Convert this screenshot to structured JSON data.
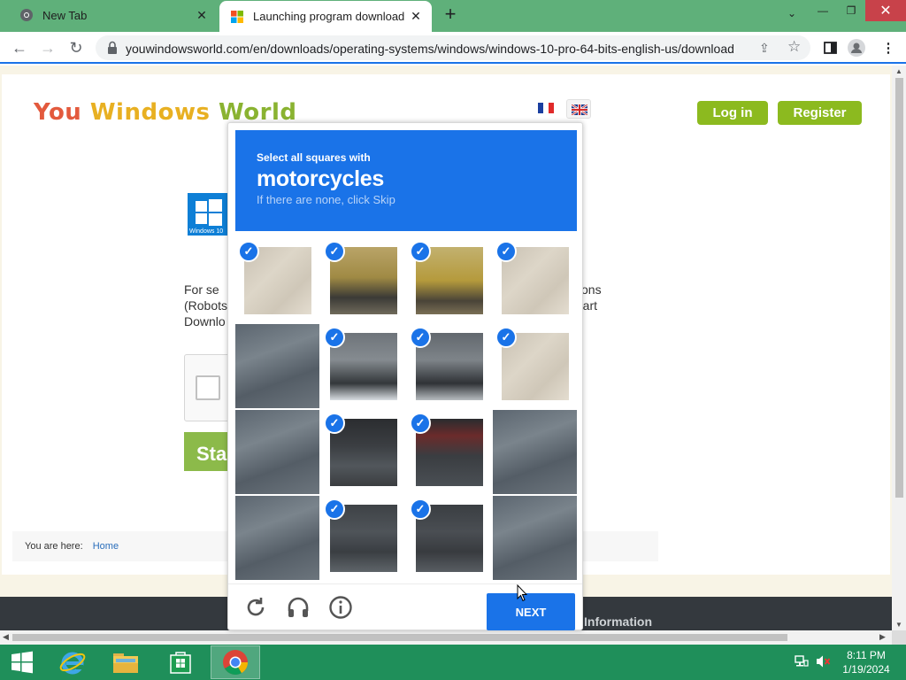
{
  "browser": {
    "tabs": [
      {
        "title": "New Tab",
        "active": false
      },
      {
        "title": "Launching program download Windows",
        "active": true
      }
    ],
    "url": "youwindowsworld.com/en/downloads/operating-systems/windows/windows-10-pro-64-bits-english-us/download"
  },
  "site": {
    "logo_word1": "You",
    "logo_word2": "Windows",
    "logo_word3": "World",
    "login_label": "Log in",
    "register_label": "Register",
    "win_logo_caption": "Windows 10",
    "text_left_1": "For se",
    "text_left_2": "(Robots",
    "text_left_3": "Downlo",
    "text_right_1": "ons",
    "text_right_2": "art",
    "start_label": "Star",
    "breadcrumb_prefix": "You are here:",
    "breadcrumb_home": "Home",
    "footer_heading": "Information"
  },
  "captcha": {
    "prompt_line1": "Select all squares with",
    "prompt_target": "motorcycles",
    "prompt_hint": "If there are none, click Skip",
    "next_label": "NEXT",
    "selected_cells": [
      0,
      1,
      2,
      3,
      5,
      6,
      7,
      9,
      10,
      13,
      14
    ],
    "cells": [
      {
        "kind": "road"
      },
      {
        "kind": "rider-top"
      },
      {
        "kind": "rider-top-right"
      },
      {
        "kind": "road"
      },
      {
        "kind": "shadow"
      },
      {
        "kind": "bike-mid"
      },
      {
        "kind": "bike-mid-right"
      },
      {
        "kind": "road"
      },
      {
        "kind": "shadow"
      },
      {
        "kind": "bike-wheel"
      },
      {
        "kind": "bike-wheel-right"
      },
      {
        "kind": "shadow"
      },
      {
        "kind": "shadow"
      },
      {
        "kind": "bike-low"
      },
      {
        "kind": "bike-low-right"
      },
      {
        "kind": "shadow"
      }
    ]
  },
  "taskbar": {
    "time": "8:11 PM",
    "date": "1/19/2024"
  }
}
